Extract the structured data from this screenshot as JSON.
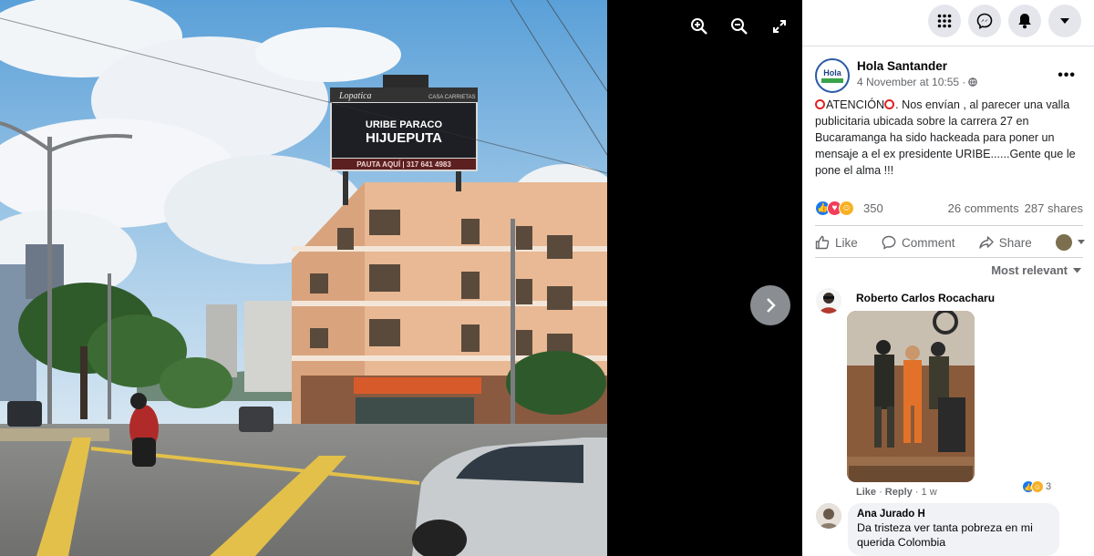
{
  "photo": {
    "billboard_brand": "Lopatica",
    "billboard_header_right": "CASA CARRIETAS",
    "billboard_line1": "URIBE PARACO",
    "billboard_line2": "HIJUEPUTA",
    "billboard_footer": "PAUTA AQUÍ | 317 641 4983"
  },
  "viewer_tools": {
    "zoom_in_icon": "zoom-in-icon",
    "zoom_out_icon": "zoom-out-icon",
    "fullscreen_icon": "fullscreen-icon",
    "next_icon": "chevron-right-icon"
  },
  "topbar": {
    "icons": [
      "menu-grid-icon",
      "messenger-icon",
      "notifications-bell-icon",
      "account-caret-icon"
    ]
  },
  "post": {
    "page_name": "Hola Santander",
    "avatar_text": "Hola",
    "time": "4 November at 10:55 ·",
    "text_part1": "ATENCIÓN",
    "text_part2": ". Nos envían , al parecer una valla publicitaria ubicada sobre la carrera 27 en Bucaramanga ha sido hackeada para poner un mensaje a el ex presidente URIBE......Gente que le pone el alma !!!",
    "reaction_count": "350",
    "comments_count": "26 comments",
    "shares_count": "287 shares",
    "colors": {
      "accent": "#1877f2",
      "love": "#f33e58",
      "haha": "#f7b125",
      "alert_ring": "#e02424"
    }
  },
  "actions": {
    "like": "Like",
    "comment": "Comment",
    "share": "Share"
  },
  "sort_label": "Most relevant",
  "comments": [
    {
      "author": "Roberto Carlos Rocacharu",
      "reaction_count": "3",
      "like_label": "Like",
      "reply_label": "Reply",
      "age": "1 w"
    },
    {
      "author": "Ana Jurado H",
      "text": "Da tristeza ver tanta pobreza en mi querida Colombia"
    }
  ]
}
